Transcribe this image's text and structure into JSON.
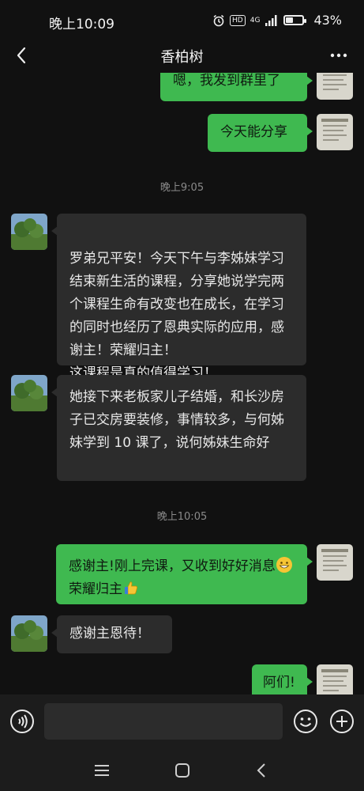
{
  "status_bar": {
    "time": "晚上10:09",
    "network": "4G",
    "hd": "HD",
    "battery_text": "43%",
    "battery_level": 0.43
  },
  "header": {
    "title": "香柏树"
  },
  "messages": [
    {
      "text": "嗯，我发到群里了"
    },
    {
      "text": "今天能分享"
    },
    {
      "timestamp": "晚上9:05"
    },
    {
      "text": "罗弟兄平安！今天下午与李姊妹学习结束新生活的课程，分享她说学完两个课程生命有改变也在成长，在学习的同时也经历了恩典实际的应用，感谢主！荣耀归主！\n这课程是真的值得学习！"
    },
    {
      "text": "她接下来老板家儿子结婚，和长沙房子已交房要装修，事情较多，与何姊妹学到 10 课了，说何姊妹生命好"
    },
    {
      "timestamp": "晚上10:05"
    },
    {
      "text_part1": "感谢主!刚上完课，又收到好好消息",
      "text_part2": "荣耀归主"
    },
    {
      "text": "感谢主恩待！"
    },
    {
      "text": "阿们!"
    }
  ],
  "colors": {
    "me_bubble": "#3fb950",
    "other_bubble": "#2c2c2c",
    "background": "#111111"
  },
  "icons": {
    "back": "chevron-left-icon",
    "more": "more-dots-icon",
    "voice": "voice-icon",
    "emoji": "emoji-icon",
    "plus": "plus-icon"
  }
}
